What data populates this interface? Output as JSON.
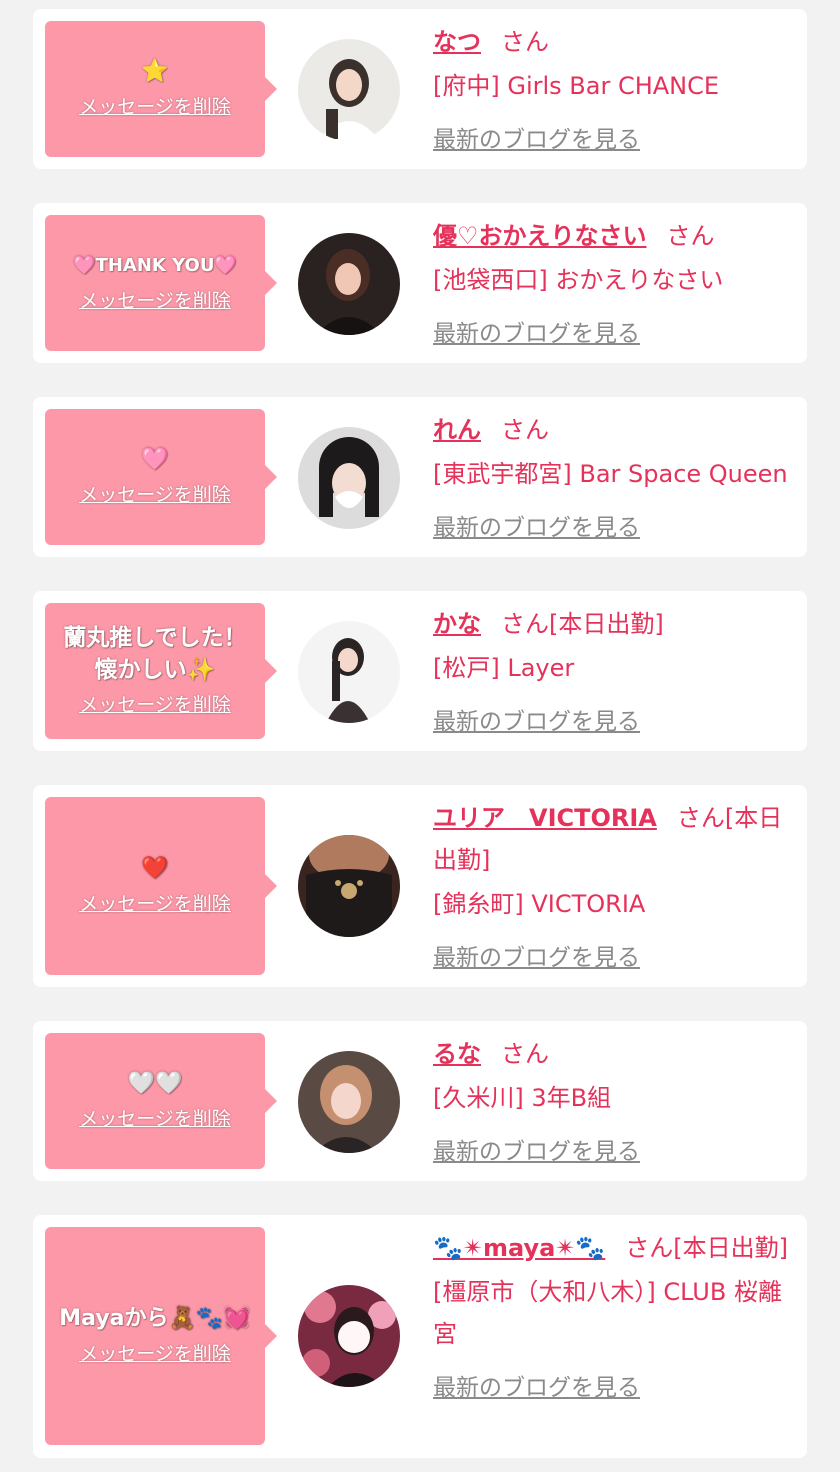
{
  "colors": {
    "background": "#f2f2f2",
    "card": "#ffffff",
    "bubble": "#fc98a8",
    "accent": "#e5325a",
    "blog_link": "#8a8a8a"
  },
  "delete_label": "メッセージを削除",
  "blog_label": "最新のブログを見る",
  "entries": [
    {
      "message": "⭐",
      "name": "なつ",
      "suffix": "さん",
      "shop": "[府中] Girls Bar CHANCE",
      "avatar_icon": "avatar-photo"
    },
    {
      "message": "🩷THANK YOU🩷",
      "name": "優♡おかえりなさい",
      "suffix": "さん",
      "shop": "[池袋西口] おかえりなさい",
      "avatar_icon": "avatar-photo"
    },
    {
      "message": "🩷",
      "name": "れん",
      "suffix": "さん",
      "shop": "[東武宇都宮] Bar Space Queen",
      "avatar_icon": "avatar-photo"
    },
    {
      "message": "蘭丸推しでした！\n懐かしい✨",
      "name": "かな",
      "suffix": "さん[本日出勤]",
      "shop": "[松戸] Layer",
      "avatar_icon": "avatar-photo"
    },
    {
      "message": "❤️",
      "name": "ユリア　VICTORIA",
      "suffix": "さん[本日出勤]",
      "shop": "[錦糸町] VICTORIA",
      "avatar_icon": "avatar-photo"
    },
    {
      "message": "🤍🤍",
      "name": "るな",
      "suffix": "さん",
      "shop": "[久米川] 3年B組",
      "avatar_icon": "avatar-photo"
    },
    {
      "message": "Mayaから🧸🐾💓",
      "name": "🐾✴maya✴🐾",
      "suffix": "さん[本日出勤]",
      "shop": "[橿原市（大和八木）] CLUB 桜離宮",
      "avatar_icon": "avatar-photo"
    }
  ]
}
